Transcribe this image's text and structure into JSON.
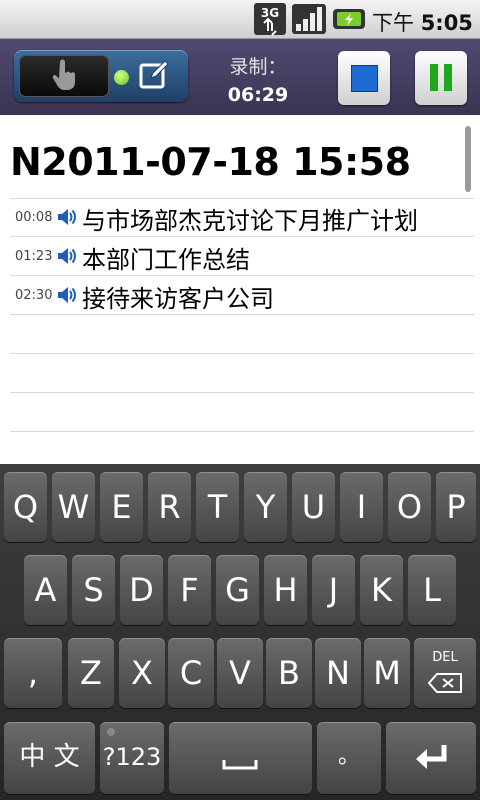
{
  "status_bar": {
    "network": "3G",
    "time_prefix": "下午",
    "time": "5:05"
  },
  "recorder": {
    "label": "录制：",
    "elapsed": "06:29"
  },
  "note": {
    "title": "N2011-07-18 15:58",
    "entries": [
      {
        "time": "00:08",
        "text": "与市场部杰克讨论下月推广计划"
      },
      {
        "time": "01:23",
        "text": "本部门工作总结"
      },
      {
        "time": "02:30",
        "text": "接待来访客户公司"
      }
    ]
  },
  "keyboard": {
    "row1": [
      "Q",
      "W",
      "E",
      "R",
      "T",
      "Y",
      "U",
      "I",
      "O",
      "P"
    ],
    "row2": [
      "A",
      "S",
      "D",
      "F",
      "G",
      "H",
      "J",
      "K",
      "L"
    ],
    "row3": [
      ",",
      "Z",
      "X",
      "C",
      "V",
      "B",
      "N",
      "M"
    ],
    "del_label": "DEL",
    "lang_label": "中 文",
    "sym_label": "?123",
    "period_label": "。"
  }
}
